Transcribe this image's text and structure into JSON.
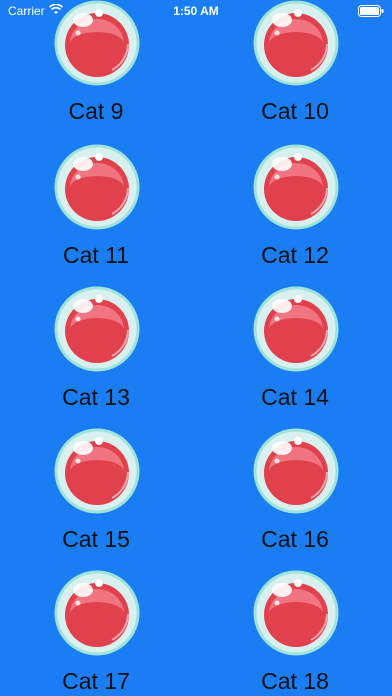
{
  "status_bar": {
    "carrier": "Carrier",
    "time": "1:50 AM"
  },
  "colors": {
    "background": "#1a7df3",
    "bubble_red": "#e0414d",
    "bubble_rim": "#9fe3dd",
    "label": "#111111"
  },
  "items": [
    {
      "label": "Cat 9",
      "icon": "cat-bubble-icon"
    },
    {
      "label": "Cat 10",
      "icon": "cat-bubble-icon"
    },
    {
      "label": "Cat 11",
      "icon": "cat-bubble-icon"
    },
    {
      "label": "Cat 12",
      "icon": "cat-bubble-icon"
    },
    {
      "label": "Cat 13",
      "icon": "cat-bubble-icon"
    },
    {
      "label": "Cat 14",
      "icon": "cat-bubble-icon"
    },
    {
      "label": "Cat 15",
      "icon": "cat-bubble-icon"
    },
    {
      "label": "Cat 16",
      "icon": "cat-bubble-icon"
    },
    {
      "label": "Cat 17",
      "icon": "cat-bubble-icon"
    },
    {
      "label": "Cat 18",
      "icon": "cat-bubble-icon"
    }
  ]
}
